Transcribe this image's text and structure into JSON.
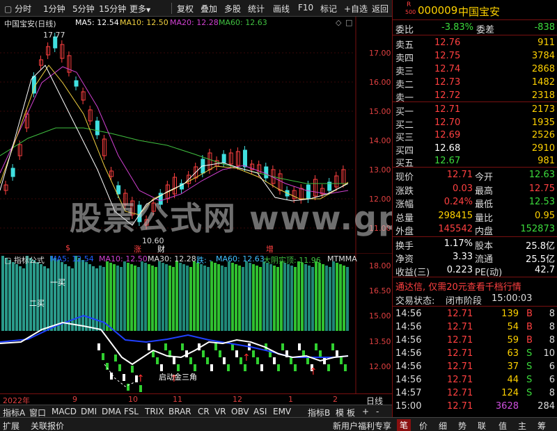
{
  "toolbar": {
    "items": [
      "分时",
      "1分钟",
      "5分钟",
      "15分钟",
      "更多",
      "复权",
      "叠加",
      "多股",
      "统计",
      "画线",
      "F10",
      "标记",
      "+自选",
      "返回"
    ]
  },
  "main_chart": {
    "title": "中国宝安(日线)",
    "ma5": "MA5: 12.54",
    "ma10": "MA10: 12.50",
    "ma20": "MA20: 12.28",
    "ma60": "MA60: 12.63",
    "high_label": "17.77",
    "low_label": "10.60",
    "y_ticks": [
      "17.00",
      "16.00",
      "15.00",
      "14.00",
      "13.00",
      "12.00",
      "11.00"
    ],
    "markers": [
      {
        "text": "$",
        "color": "#ff4040"
      },
      {
        "text": "涨",
        "color": "#ff4040"
      },
      {
        "text": "财",
        "color": "#ffffff"
      },
      {
        "text": "增",
        "color": "#ff4040"
      }
    ]
  },
  "indicator": {
    "title": "指标公式",
    "ma5": "MA5: 12.54",
    "ma10": "MA10: 12.50",
    "ma30": "MA30: 12.28",
    "die": "跌: -",
    "ma60": "MA60: 12.63",
    "dayin": "大阴实顶: 11.96",
    "mtm": "MTMMA",
    "y_ticks": [
      "18.00",
      "16.50",
      "15.00",
      "13.50",
      "12.00"
    ],
    "annot_1": "一买",
    "annot_2": "二买",
    "annot_3": "启动金三角"
  },
  "time_axis": {
    "labels": [
      "2022年",
      "9",
      "10",
      "11",
      "12",
      "1",
      "2"
    ],
    "period": "日线"
  },
  "bottom_tabs": [
    "指标A",
    "窗口",
    "MACD",
    "DMI",
    "DMA",
    "FSL",
    "TRIX",
    "BRAR",
    "CR",
    "VR",
    "OBV",
    "ASI",
    "EMV",
    "指标B",
    "模",
    "板",
    "+",
    "-"
  ],
  "status_bar": {
    "left": [
      "扩展",
      "关联报价"
    ],
    "promo": "新用户福利专享",
    "tabs": [
      "笔",
      "价",
      "细",
      "势",
      "联",
      "值",
      "主",
      "筹"
    ]
  },
  "watermark": "股票公式网 www.gpsxs.com",
  "quote": {
    "code": "000009",
    "name": "中国宝安",
    "r_label": "R",
    "r_sub": "500",
    "weibi_label": "委比",
    "weibi": "-3.83%",
    "weicha_label": "委差",
    "weicha": "-838",
    "asks": [
      {
        "label": "卖五",
        "price": "12.76",
        "vol": "911"
      },
      {
        "label": "卖四",
        "price": "12.75",
        "vol": "3784"
      },
      {
        "label": "卖三",
        "price": "12.74",
        "vol": "2868"
      },
      {
        "label": "卖二",
        "price": "12.73",
        "vol": "1482"
      },
      {
        "label": "卖一",
        "price": "12.72",
        "vol": "2318"
      }
    ],
    "bids": [
      {
        "label": "买一",
        "price": "12.71",
        "vol": "2173",
        "pc": "red"
      },
      {
        "label": "买二",
        "price": "12.70",
        "vol": "1935",
        "pc": "red"
      },
      {
        "label": "买三",
        "price": "12.69",
        "vol": "2526",
        "pc": "red"
      },
      {
        "label": "买四",
        "price": "12.68",
        "vol": "2910",
        "pc": "white"
      },
      {
        "label": "买五",
        "price": "12.67",
        "vol": "981",
        "pc": "green"
      }
    ],
    "stats": [
      {
        "l1": "现价",
        "v1": "12.71",
        "c1": "red",
        "l2": "今开",
        "v2": "12.63",
        "c2": "green"
      },
      {
        "l1": "涨跌",
        "v1": "0.03",
        "c1": "red",
        "l2": "最高",
        "v2": "12.75",
        "c2": "red"
      },
      {
        "l1": "涨幅",
        "v1": "0.24%",
        "c1": "red",
        "l2": "最低",
        "v2": "12.53",
        "c2": "green"
      },
      {
        "l1": "总量",
        "v1": "298415",
        "c1": "yellow",
        "l2": "量比",
        "v2": "0.95",
        "c2": "yellow"
      },
      {
        "l1": "外盘",
        "v1": "145542",
        "c1": "red",
        "l2": "内盘",
        "v2": "152873",
        "c2": "green"
      }
    ],
    "stats2": [
      {
        "l1": "换手",
        "v1": "1.17%",
        "l2": "股本",
        "v2": "25.8亿"
      },
      {
        "l1": "净资",
        "v1": "3.33",
        "l2": "流通",
        "v2": "25.5亿"
      },
      {
        "l1": "收益(三)",
        "v1": "0.223",
        "l2": "PE(动)",
        "v2": "42.7"
      }
    ],
    "promo": "通达信, 仅需20元查看千档行情",
    "trade_status_label": "交易状态:",
    "trade_status": "闭市阶段",
    "trade_time": "15:00:03",
    "ticks": [
      {
        "t": "14:56",
        "p": "12.71",
        "v": "139",
        "s": "B",
        "n": "8",
        "sc": "red"
      },
      {
        "t": "14:56",
        "p": "12.71",
        "v": "54",
        "s": "B",
        "n": "8",
        "sc": "red"
      },
      {
        "t": "14:56",
        "p": "12.71",
        "v": "59",
        "s": "B",
        "n": "8",
        "sc": "red"
      },
      {
        "t": "14:56",
        "p": "12.71",
        "v": "63",
        "s": "S",
        "n": "10",
        "sc": "green"
      },
      {
        "t": "14:56",
        "p": "12.71",
        "v": "37",
        "s": "S",
        "n": "6",
        "sc": "green"
      },
      {
        "t": "14:56",
        "p": "12.71",
        "v": "44",
        "s": "S",
        "n": "6",
        "sc": "green"
      },
      {
        "t": "14:57",
        "p": "12.71",
        "v": "124",
        "s": "S",
        "n": "8",
        "sc": "green"
      },
      {
        "t": "15:00",
        "p": "12.71",
        "v": "3628",
        "s": "",
        "n": "284",
        "sc": "white"
      }
    ]
  }
}
